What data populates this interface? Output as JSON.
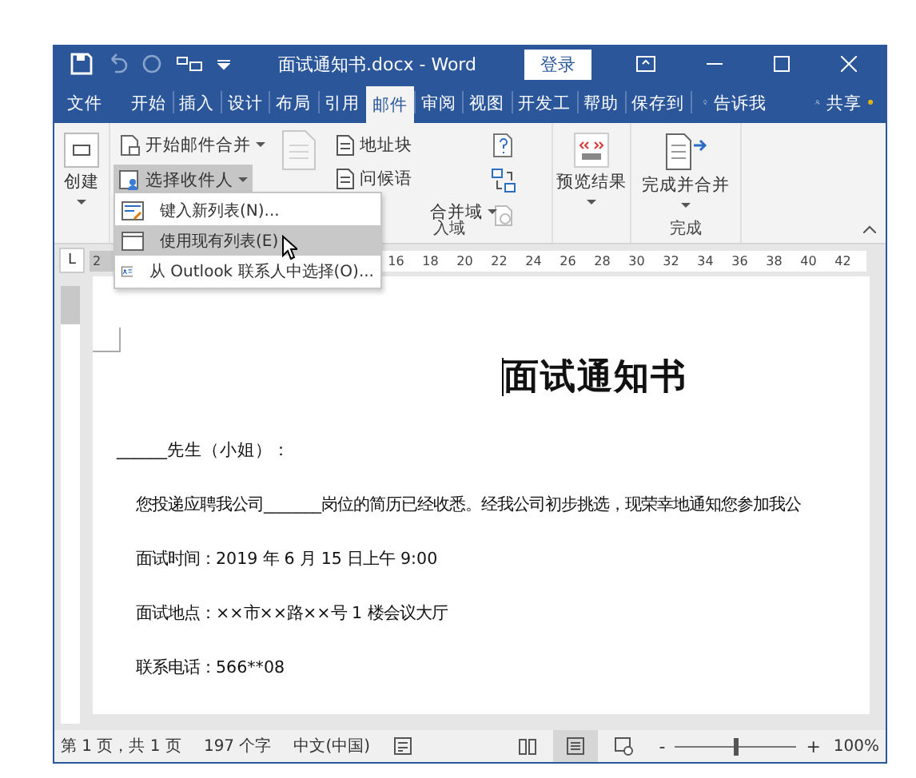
{
  "window": {
    "title": "面试通知书.docx  -  Word",
    "login_button": "登录"
  },
  "tabs": [
    {
      "label": "文件",
      "selected": false
    },
    {
      "label": "开始",
      "selected": false
    },
    {
      "label": "插入",
      "selected": false
    },
    {
      "label": "设计",
      "selected": false
    },
    {
      "label": "布局",
      "selected": false
    },
    {
      "label": "引用",
      "selected": false
    },
    {
      "label": "邮件",
      "selected": true
    },
    {
      "label": "审阅",
      "selected": false
    },
    {
      "label": "视图",
      "selected": false
    },
    {
      "label": "开发工",
      "selected": false
    },
    {
      "label": "帮助",
      "selected": false
    },
    {
      "label": "保存到",
      "selected": false
    }
  ],
  "tell_me": "告诉我",
  "share": "共享",
  "ribbon": {
    "create": "创建",
    "start_merge": "开始邮件合并",
    "select_recipients": {
      "label": "选择收件人",
      "open": true
    },
    "address_block": "地址块",
    "greeting_line": "问候语",
    "merge_field": "合并域",
    "write_group": "入域",
    "preview": "预览结果",
    "finish": "完成并合并",
    "finish_group": "完成"
  },
  "recipient_menu": [
    {
      "label": "键入新列表(N)...",
      "selected": false
    },
    {
      "label": "使用现有列表(E)",
      "selected": true
    },
    {
      "label": "从 Outlook 联系人中选择(O)...",
      "selected": false
    }
  ],
  "tab_selector": "L",
  "ruler": {
    "first": "2",
    "marks": [
      "16",
      "18",
      "20",
      "22",
      "24",
      "26",
      "28",
      "30",
      "32",
      "34",
      "36",
      "38",
      "40",
      "42"
    ]
  },
  "document": {
    "heading": "面试通知书",
    "salutation": "______先生（小姐）：",
    "paragraphs": [
      "您投递应聘我公司_______岗位的简历已经收悉。经我公司初步挑选，现荣幸地通知您参加我公",
      "面试时间：2019 年 6 月 15 日上午 9:00",
      "面试地点：××市××路××号 1 楼会议大厅",
      "联系电话：566**08"
    ]
  },
  "status_bar": {
    "page": "第 1 页，共 1 页",
    "words": "197 个字",
    "language": "中文(中国)",
    "views": [
      {
        "kind": "read",
        "selected": false
      },
      {
        "kind": "print",
        "selected": true
      },
      {
        "kind": "web",
        "selected": false
      }
    ],
    "zoom_out": "-",
    "zoom_in": "+",
    "zoom": "100%",
    "zoom_slider": {
      "level": 0.5
    }
  }
}
